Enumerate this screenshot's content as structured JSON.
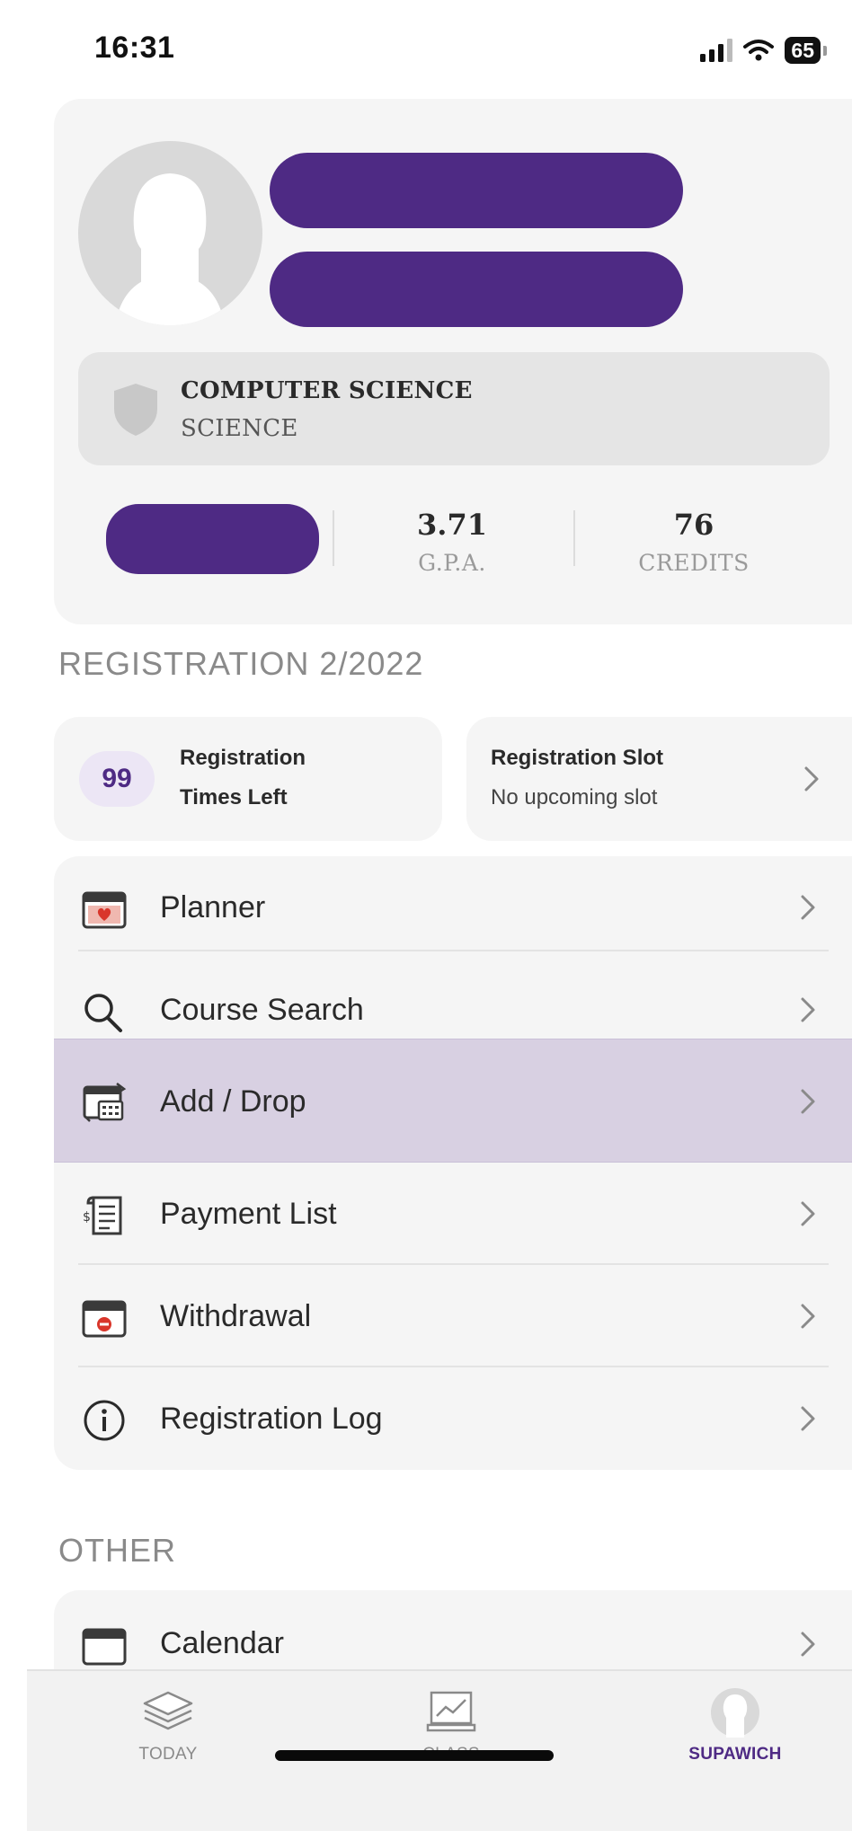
{
  "status_bar": {
    "time": "16:31",
    "battery": "65"
  },
  "profile": {
    "program": "COMPUTER SCIENCE",
    "faculty": "SCIENCE",
    "gpa_value": "3.71",
    "gpa_label": "G.P.A.",
    "credits_value": "76",
    "credits_label": "CREDITS"
  },
  "registration": {
    "section_title": "REGISTRATION 2/2022",
    "times_left_count": "99",
    "times_left_line1": "Registration",
    "times_left_line2": "Times Left",
    "slot_title": "Registration Slot",
    "slot_status": "No upcoming slot"
  },
  "menu": {
    "items": [
      {
        "label": "Planner",
        "icon": "planner-icon"
      },
      {
        "label": "Course Search",
        "icon": "search-icon"
      },
      {
        "label": "Add / Drop",
        "icon": "add-drop-icon"
      },
      {
        "label": "Payment List",
        "icon": "receipt-icon"
      },
      {
        "label": "Withdrawal",
        "icon": "withdrawal-icon"
      },
      {
        "label": "Registration Log",
        "icon": "info-icon"
      }
    ]
  },
  "other": {
    "section_title": "OTHER",
    "items": [
      {
        "label": "Calendar",
        "icon": "calendar-icon"
      }
    ]
  },
  "tab_bar": {
    "tabs": [
      {
        "label": "TODAY",
        "icon": "layers-icon"
      },
      {
        "label": "CLASS",
        "icon": "chart-board-icon"
      },
      {
        "label": "SUPAWICH",
        "icon": "avatar-icon",
        "active": true
      }
    ]
  },
  "colors": {
    "accent": "#4e2a84",
    "highlight": "#d8d0e2",
    "card": "#f5f5f5",
    "muted": "#8a8a8a"
  }
}
